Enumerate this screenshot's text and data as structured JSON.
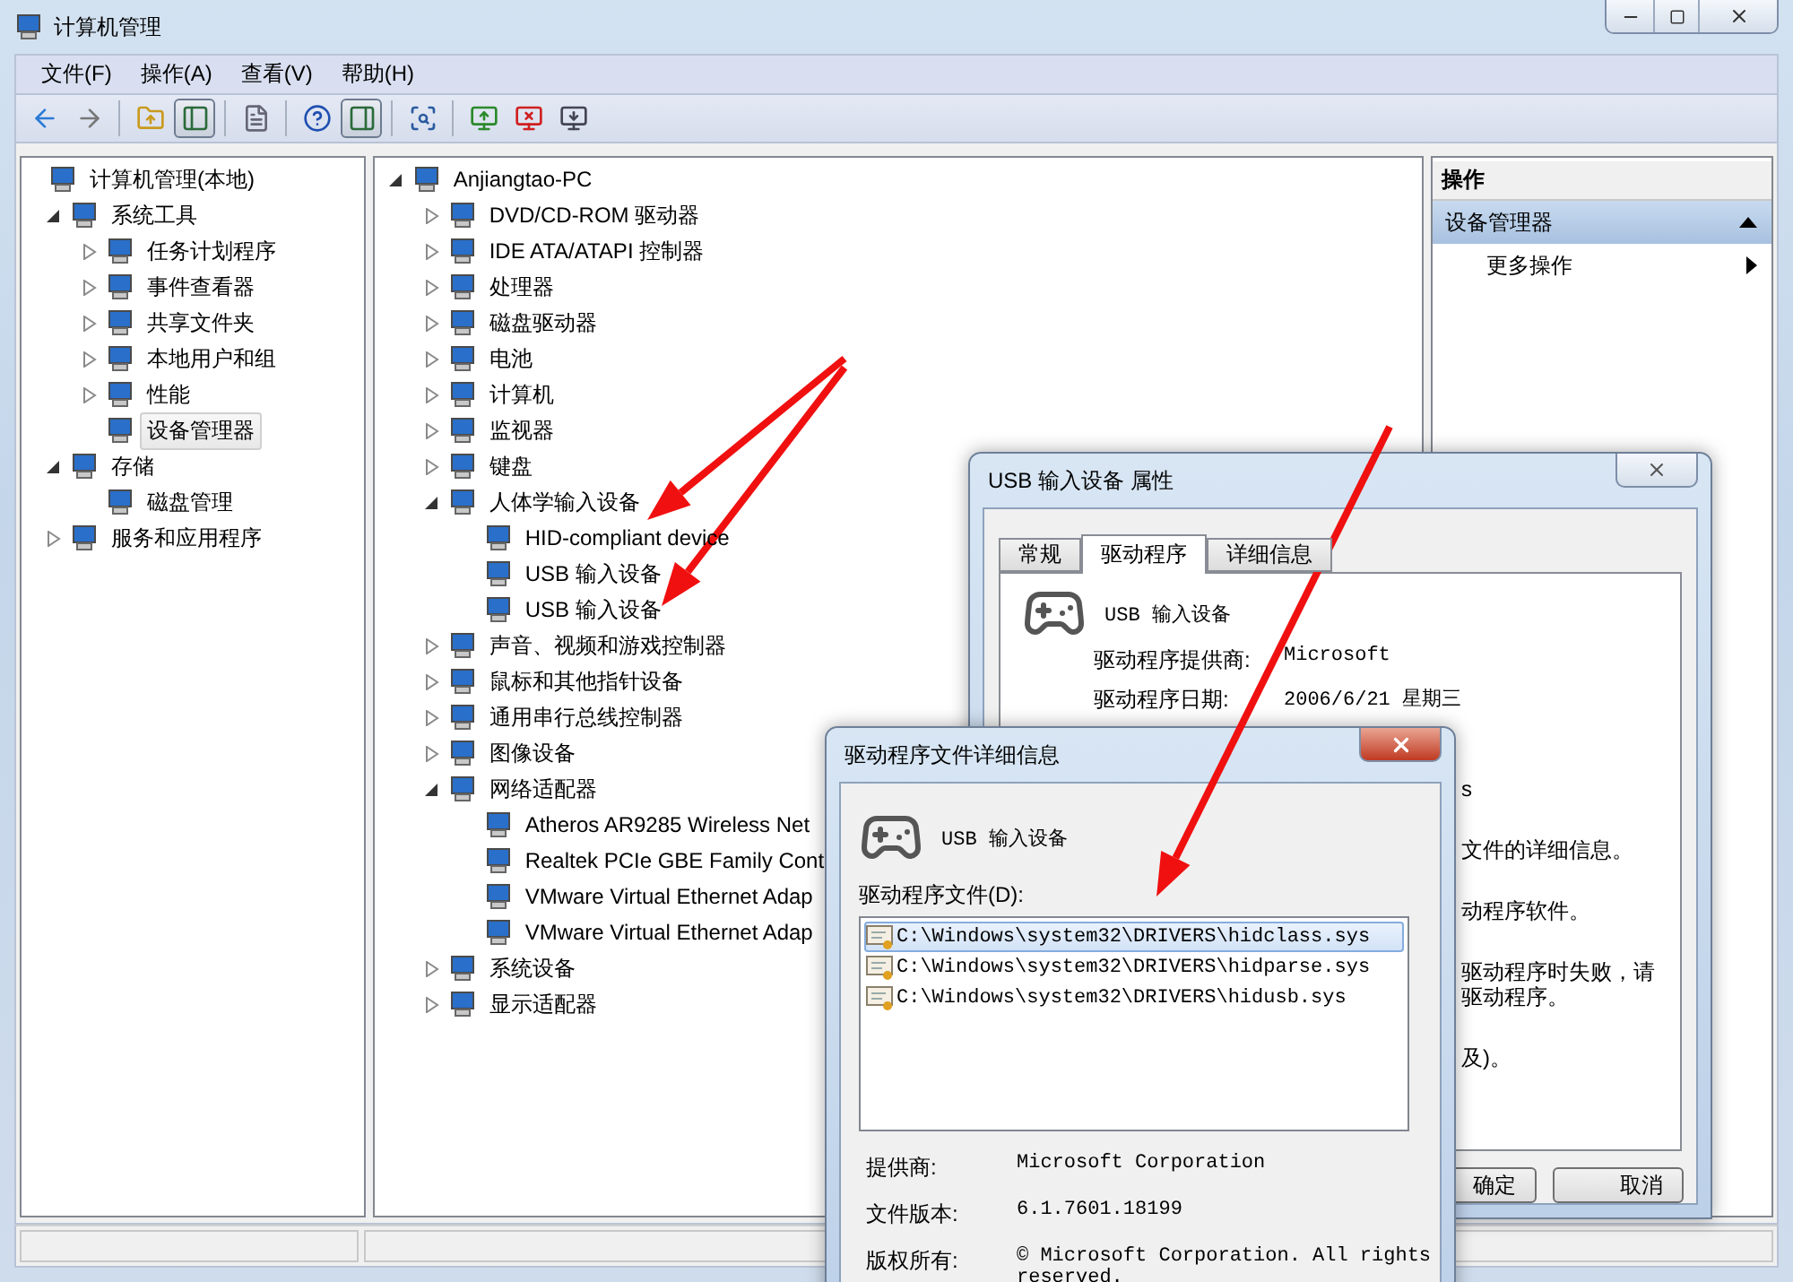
{
  "window": {
    "title": "计算机管理"
  },
  "menu": [
    "文件(F)",
    "操作(A)",
    "查看(V)",
    "帮助(H)"
  ],
  "toolbar": [
    [
      {
        "kind": "back",
        "pressed": false
      },
      {
        "kind": "forward",
        "pressed": false
      }
    ],
    [
      {
        "kind": "up",
        "pressed": false
      },
      {
        "kind": "console_tree",
        "pressed": true
      }
    ],
    [
      {
        "kind": "export",
        "pressed": false
      }
    ],
    [
      {
        "kind": "help",
        "pressed": false
      },
      {
        "kind": "action_pane",
        "pressed": true
      }
    ],
    [
      {
        "kind": "scan",
        "pressed": false
      }
    ],
    [
      {
        "kind": "update",
        "pressed": false
      },
      {
        "kind": "uninstall",
        "pressed": false
      },
      {
        "kind": "disable",
        "pressed": false
      }
    ]
  ],
  "console_tree": [
    {
      "label": "计算机管理(本地)",
      "selected": false,
      "children": [
        {
          "label": "系统工具",
          "expanded": true,
          "selected": false,
          "children": [
            {
              "label": "任务计划程序",
              "expanded": false,
              "selected": false
            },
            {
              "label": "事件查看器",
              "expanded": false,
              "selected": false
            },
            {
              "label": "共享文件夹",
              "expanded": false,
              "selected": false
            },
            {
              "label": "本地用户和组",
              "expanded": false,
              "selected": false
            },
            {
              "label": "性能",
              "expanded": false,
              "selected": false
            },
            {
              "label": "设备管理器",
              "selected": true
            }
          ]
        },
        {
          "label": "存储",
          "expanded": true,
          "selected": false,
          "children": [
            {
              "label": "磁盘管理",
              "selected": false
            }
          ]
        },
        {
          "label": "服务和应用程序",
          "expanded": false,
          "selected": false
        }
      ]
    }
  ],
  "device_tree": [
    {
      "label": "Anjiangtao-PC",
      "expanded": true,
      "children": [
        {
          "label": "DVD/CD-ROM 驱动器",
          "expanded": false
        },
        {
          "label": "IDE ATA/ATAPI 控制器",
          "expanded": false
        },
        {
          "label": "处理器",
          "expanded": false
        },
        {
          "label": "磁盘驱动器",
          "expanded": false
        },
        {
          "label": "电池",
          "expanded": false
        },
        {
          "label": "计算机",
          "expanded": false
        },
        {
          "label": "监视器",
          "expanded": false
        },
        {
          "label": "键盘",
          "expanded": false
        },
        {
          "label": "人体学输入设备",
          "expanded": true,
          "children": [
            {
              "label": "HID-compliant device"
            },
            {
              "label": "USB 输入设备"
            },
            {
              "label": "USB 输入设备"
            }
          ]
        },
        {
          "label": "声音、视频和游戏控制器",
          "expanded": false
        },
        {
          "label": "鼠标和其他指针设备",
          "expanded": false
        },
        {
          "label": "通用串行总线控制器",
          "expanded": false
        },
        {
          "label": "图像设备",
          "expanded": false
        },
        {
          "label": "网络适配器",
          "expanded": true,
          "children": [
            {
              "label": "Atheros AR9285 Wireless Net"
            },
            {
              "label": "Realtek PCIe GBE Family Cont"
            },
            {
              "label": "VMware Virtual Ethernet Adap"
            },
            {
              "label": "VMware Virtual Ethernet Adap"
            }
          ]
        },
        {
          "label": "系统设备",
          "expanded": false
        },
        {
          "label": "显示适配器",
          "expanded": false
        }
      ]
    }
  ],
  "actions_pane": {
    "header": "操作",
    "section": "设备管理器",
    "items": [
      "更多操作"
    ]
  },
  "properties_dialog": {
    "title": "USB 输入设备 属性",
    "tabs": [
      {
        "label": "常规",
        "selected": false
      },
      {
        "label": "驱动程序",
        "selected": true
      },
      {
        "label": "详细信息",
        "selected": false
      }
    ],
    "device_name": "USB 输入设备",
    "fields": [
      {
        "label": "驱动程序提供商:",
        "value": "Microsoft"
      },
      {
        "label": "驱动程序日期:",
        "value": "2006/6/21 星期三"
      }
    ],
    "partial_paragraphs": [
      [
        "s"
      ],
      [
        "文件的详细信息。"
      ],
      [
        "动程序软件。"
      ],
      [
        "驱动程序时失败，请",
        "驱动程序。"
      ],
      [
        "及)。"
      ]
    ],
    "buttons": [
      "确定",
      "取消"
    ]
  },
  "file_details_dialog": {
    "title": "驱动程序文件详细信息",
    "device_name": "USB 输入设备",
    "files_label": "驱动程序文件(D):",
    "files": [
      {
        "path": "C:\\Windows\\system32\\DRIVERS\\hidclass.sys",
        "selected": true
      },
      {
        "path": "C:\\Windows\\system32\\DRIVERS\\hidparse.sys",
        "selected": false
      },
      {
        "path": "C:\\Windows\\system32\\DRIVERS\\hidusb.sys",
        "selected": false
      }
    ],
    "info": [
      {
        "label": "提供商:",
        "value": "Microsoft Corporation"
      },
      {
        "label": "文件版本:",
        "value": "6.1.7601.18199"
      },
      {
        "label": "版权所有:",
        "value": "© Microsoft Corporation. All rights reserved."
      }
    ]
  }
}
